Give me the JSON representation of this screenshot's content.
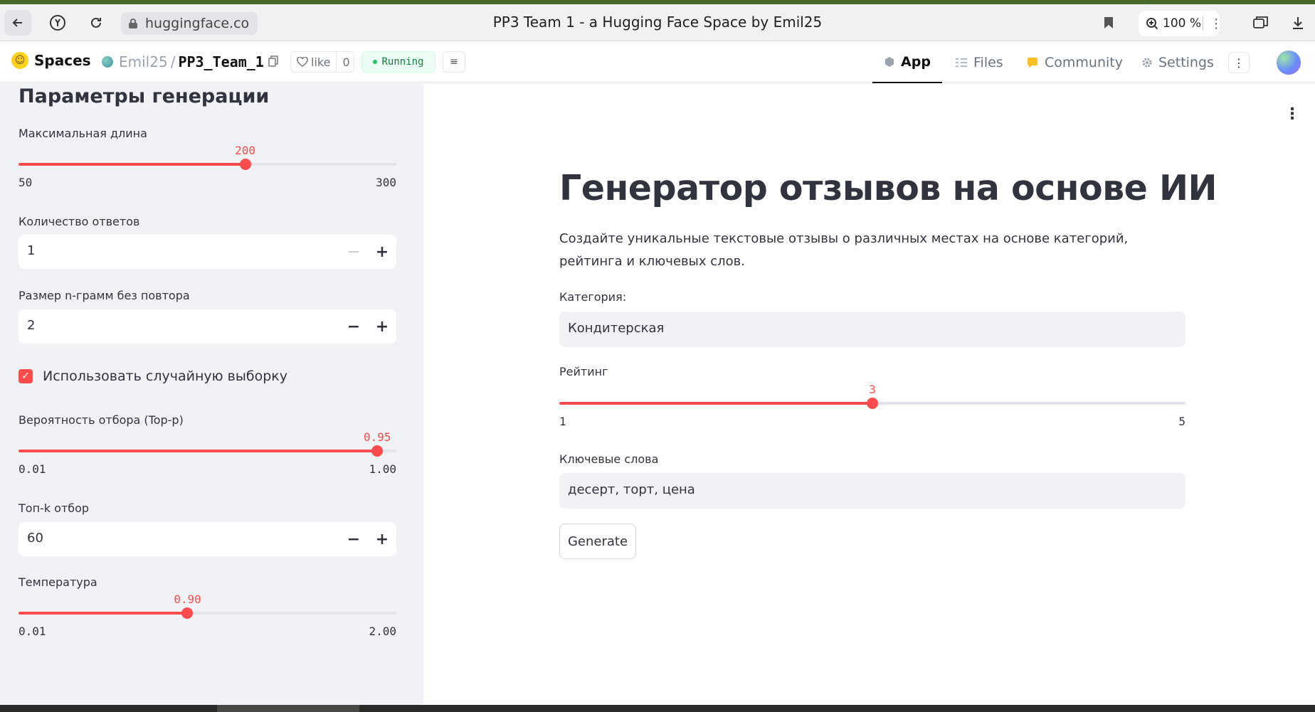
{
  "browser": {
    "domain": "huggingface.co",
    "page_title": "PP3 Team 1 - a Hugging Face Space by Emil25",
    "zoom": "100 %"
  },
  "hf": {
    "brand": "Spaces",
    "owner": "Emil25",
    "separator": "/",
    "repo": "PP3_Team_1",
    "like_label": "like",
    "like_count": "0",
    "status": "Running",
    "tabs": [
      {
        "label": "App",
        "icon": "cube-icon",
        "active": true
      },
      {
        "label": "Files",
        "icon": "files-icon",
        "active": false
      },
      {
        "label": "Community",
        "icon": "community-icon",
        "active": false
      },
      {
        "label": "Settings",
        "icon": "gear-icon",
        "active": false
      }
    ]
  },
  "sidebar": {
    "title": "Параметры генерации",
    "max_length": {
      "label": "Максимальная длина",
      "value": "200",
      "min": "50",
      "max": "300",
      "fraction": 0.6
    },
    "num_answers": {
      "label": "Количество ответов",
      "value": "1"
    },
    "ngram": {
      "label": "Размер n-грамм без повтора",
      "value": "2"
    },
    "sampling": {
      "label": "Использовать случайную выборку",
      "checked": true
    },
    "top_p": {
      "label": "Вероятность отбора (Top-p)",
      "value": "0.95",
      "min": "0.01",
      "max": "1.00",
      "fraction": 0.9495
    },
    "top_k": {
      "label": "Топ-k отбор",
      "value": "60"
    },
    "temperature": {
      "label": "Температура",
      "value": "0.90",
      "min": "0.01",
      "max": "2.00",
      "fraction": 0.4472
    }
  },
  "main": {
    "title": "Генератор отзывов на основе ИИ",
    "description": "Создайте уникальные текстовые отзывы о различных местах на основе категорий, рейтинга и ключевых слов.",
    "category": {
      "label": "Категория:",
      "value": "Кондитерская"
    },
    "rating": {
      "label": "Рейтинг",
      "value": "3",
      "min": "1",
      "max": "5",
      "fraction": 0.5
    },
    "keywords": {
      "label": "Ключевые слова",
      "value": "десерт, торт, цена"
    },
    "generate_label": "Generate"
  },
  "colors": {
    "accent": "#ff4b4b",
    "sidebar_bg": "#f0f2f6",
    "text": "#31333f"
  }
}
